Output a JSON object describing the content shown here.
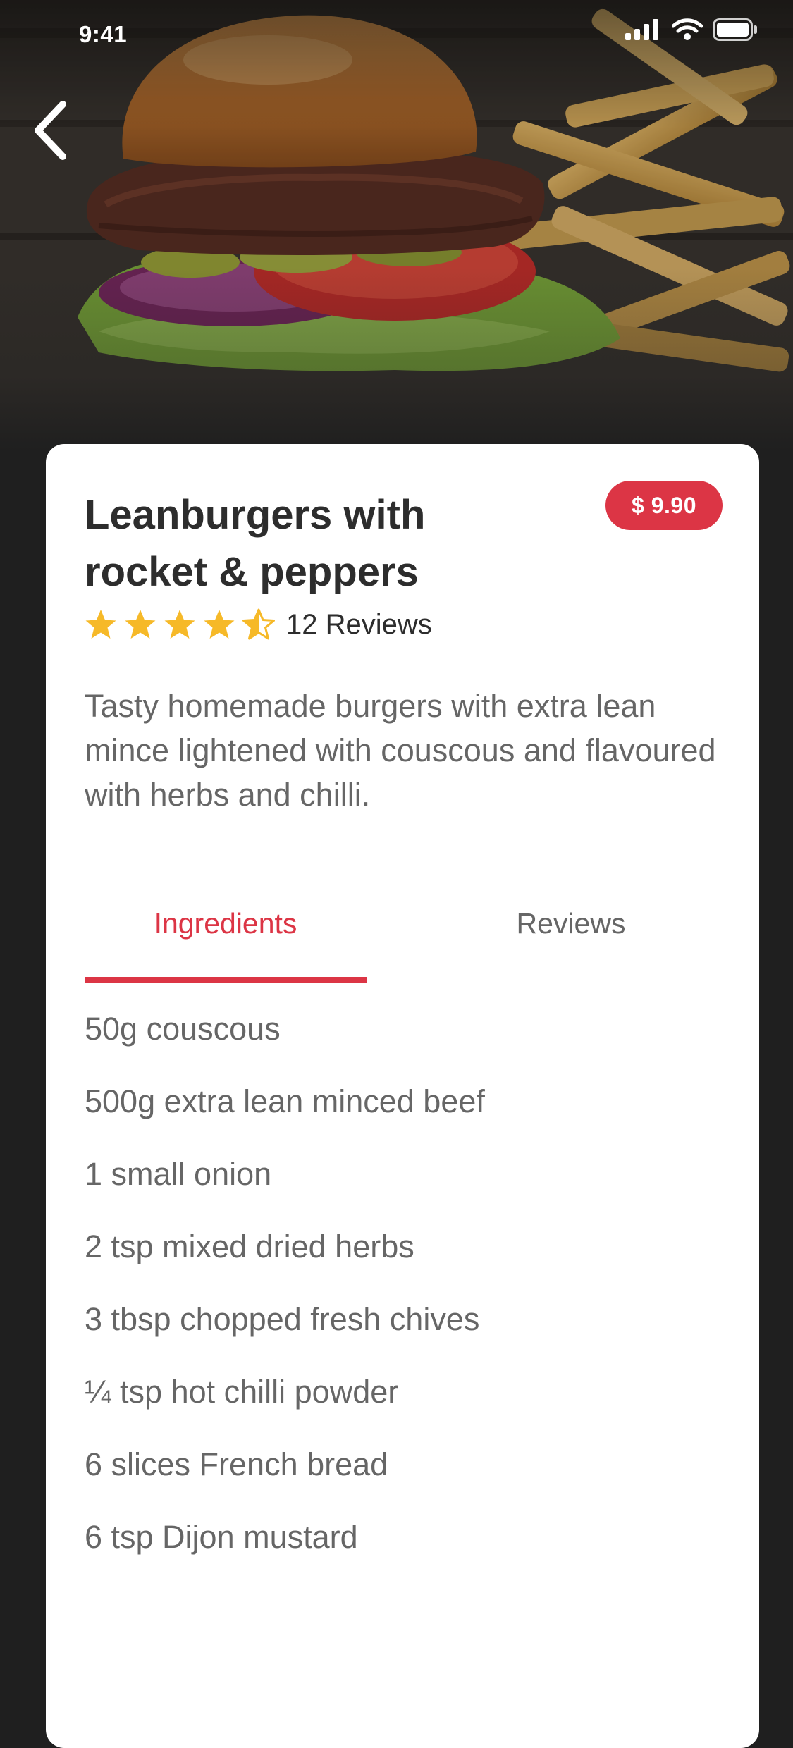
{
  "status_bar": {
    "time": "9:41"
  },
  "navigation": {
    "back_icon": "chevron-left-icon"
  },
  "recipe": {
    "title": "Leanburgers with rocket & peppers",
    "price": "$ 9.90",
    "rating": 4.5,
    "rating_max": 5,
    "reviews_label": "12 Reviews",
    "description": "Tasty homemade burgers with extra lean mince lightened with couscous and flavoured with herbs and chilli."
  },
  "tabs": {
    "active": "Ingredients",
    "items": [
      {
        "label": "Ingredients"
      },
      {
        "label": "Reviews"
      }
    ]
  },
  "ingredients": [
    "50g couscous",
    "500g extra lean minced beef",
    "1 small onion",
    "2 tsp mixed dried herbs",
    "3 tbsp chopped fresh chives",
    "¼ tsp hot chilli powder",
    "6 slices French bread",
    "6 tsp Dijon mustard"
  ],
  "colors": {
    "accent": "#dc3545",
    "star": "#f6b928",
    "title": "#2d2d2d",
    "body_text": "#666666",
    "background": "#1f1f1f",
    "card": "#ffffff"
  }
}
